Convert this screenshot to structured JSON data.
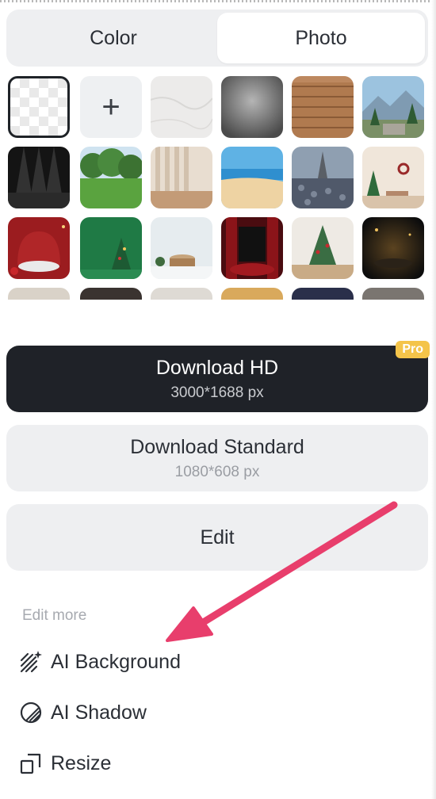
{
  "tabs": [
    {
      "label": "Color",
      "selected": false
    },
    {
      "label": "Photo",
      "selected": true
    }
  ],
  "backgrounds": [
    {
      "name": "transparent",
      "kind": "transparent"
    },
    {
      "name": "add",
      "kind": "add",
      "glyph": "+"
    },
    {
      "name": "marble",
      "kind": "photo"
    },
    {
      "name": "concrete-gray",
      "kind": "photo"
    },
    {
      "name": "wood-planks",
      "kind": "photo"
    },
    {
      "name": "mountain-forest",
      "kind": "photo"
    },
    {
      "name": "spotlight-dark",
      "kind": "photo"
    },
    {
      "name": "green-lawn",
      "kind": "photo"
    },
    {
      "name": "curtain-room",
      "kind": "photo"
    },
    {
      "name": "beach",
      "kind": "photo"
    },
    {
      "name": "eiffel-street",
      "kind": "photo"
    },
    {
      "name": "christmas-room",
      "kind": "photo"
    },
    {
      "name": "red-podium",
      "kind": "photo"
    },
    {
      "name": "green-christmas",
      "kind": "photo"
    },
    {
      "name": "wood-stump-winter",
      "kind": "photo"
    },
    {
      "name": "red-stage",
      "kind": "photo"
    },
    {
      "name": "christmas-tree-white",
      "kind": "photo"
    },
    {
      "name": "dark-gold-bokeh",
      "kind": "photo"
    }
  ],
  "download_hd": {
    "title": "Download HD",
    "size": "3000*1688 px",
    "badge": "Pro"
  },
  "download_standard": {
    "title": "Download Standard",
    "size": "1080*608 px"
  },
  "edit": {
    "label": "Edit"
  },
  "edit_more": {
    "heading": "Edit more",
    "items": [
      {
        "label": "AI Background",
        "icon": "ai-background-icon"
      },
      {
        "label": "AI Shadow",
        "icon": "ai-shadow-icon"
      },
      {
        "label": "Resize",
        "icon": "resize-icon"
      }
    ]
  },
  "colors": {
    "accent_dark": "#1f2228",
    "pro_badge": "#f4c44a",
    "annotation_arrow": "#e83e6c"
  }
}
